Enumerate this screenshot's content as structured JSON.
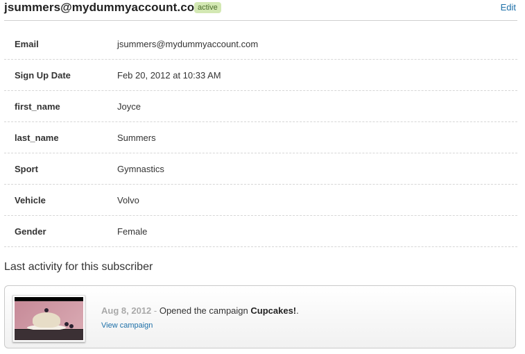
{
  "subscriber": {
    "email": "jsummers@mydummyaccount.com",
    "status": "active",
    "edit_label": "Edit"
  },
  "fields": [
    {
      "label": "Email",
      "value": "jsummers@mydummyaccount.com"
    },
    {
      "label": "Sign Up Date",
      "value": "Feb 20, 2012 at 10:33 AM"
    },
    {
      "label": "first_name",
      "value": "Joyce"
    },
    {
      "label": "last_name",
      "value": "Summers"
    },
    {
      "label": "Sport",
      "value": "Gymnastics"
    },
    {
      "label": "Vehicle",
      "value": "Volvo"
    },
    {
      "label": "Gender",
      "value": "Female"
    }
  ],
  "activity": {
    "heading": "Last activity for this subscriber",
    "date": "Aug 8, 2012",
    "separator": " - ",
    "text": "Opened the campaign ",
    "campaign": "Cupcakes!",
    "end": ".",
    "view_label": "View campaign",
    "thumbnail_icon": "campaign-thumbnail"
  },
  "colors": {
    "link": "#1c6fa8",
    "badge_bg": "#d3e8b3",
    "badge_text": "#4a6b2a"
  }
}
